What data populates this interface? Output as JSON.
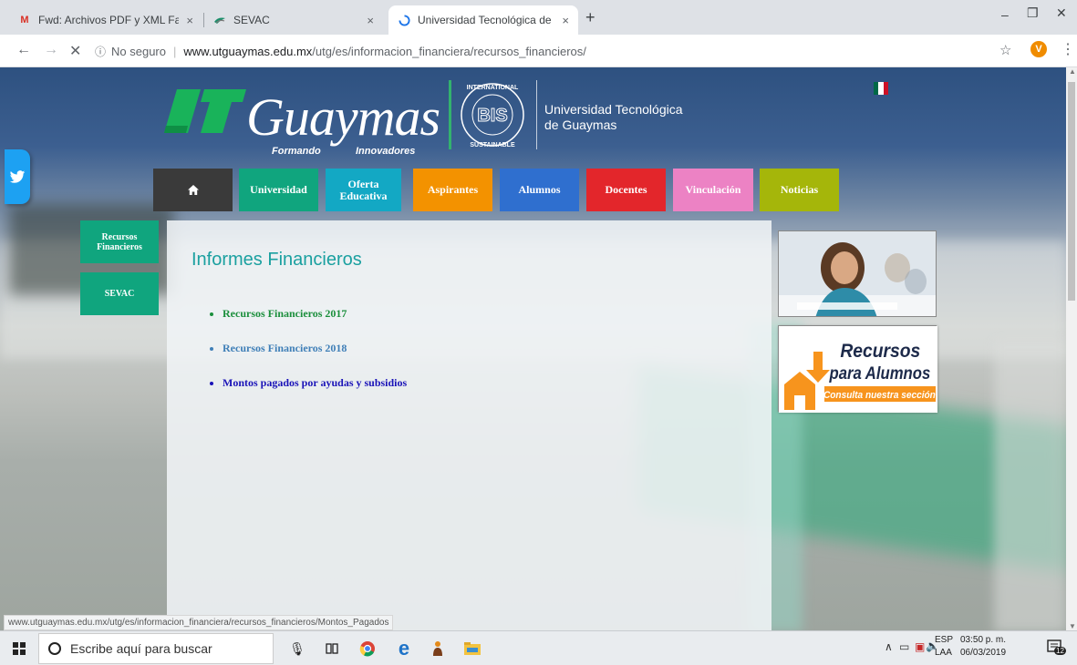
{
  "browser": {
    "tabs": [
      {
        "title": "Fwd: Archivos PDF y XML Factura",
        "icon": "gmail-icon"
      },
      {
        "title": "SEVAC",
        "icon": "sevac-favicon"
      },
      {
        "title": "Universidad Tecnológica de Guay",
        "icon": "loading-spinner-icon",
        "active": true
      }
    ],
    "close_glyph": "×",
    "new_tab_glyph": "+",
    "window_controls": {
      "minimize": "–",
      "restore": "❐",
      "close": "✕"
    },
    "nav": {
      "back": "←",
      "forward": "→",
      "stop": "✕"
    },
    "security_label": "No seguro",
    "url_host": "www.utguaymas.edu.mx",
    "url_path": "/utg/es/informacion_financiera/recursos_financieros/",
    "profile_initial": "V",
    "status_url": "www.utguaymas.edu.mx/utg/es/informacion_financiera/recursos_financieros/Montos_Pagados"
  },
  "header": {
    "logo_ut": "UT",
    "logo_word": "Guaymas",
    "logo_tag_left": "Formando",
    "logo_tag_right": "Innovadores",
    "seal_text": "BIS",
    "seal_ring_top": "BILINGUAL  INTERNATIONAL",
    "seal_ring_bottom": "SUSTAINABLE",
    "university_name_line1": "Universidad Tecnológica",
    "university_name_line2": "de Guaymas"
  },
  "nav": {
    "items": [
      {
        "label": "",
        "icon": "home-icon",
        "color": "#3a3a3a"
      },
      {
        "label": "Universidad",
        "color": "#10a57e"
      },
      {
        "label": "Oferta Educativa",
        "color": "#13a8c4"
      },
      {
        "label": "Aspirantes",
        "color": "#f39200"
      },
      {
        "label": "Alumnos",
        "color": "#2f6fcf"
      },
      {
        "label": "Docentes",
        "color": "#e3262b"
      },
      {
        "label": "Vinculación",
        "color": "#ec82c4"
      },
      {
        "label": "Noticias",
        "color": "#a5b60a"
      }
    ]
  },
  "sidebar": {
    "items": [
      {
        "label": "Recursos Financieros"
      },
      {
        "label": "SEVAC"
      }
    ]
  },
  "main": {
    "title": "Informes Financieros",
    "links": [
      {
        "label": "Recursos Financieros 2017",
        "color": "#1b8f3c"
      },
      {
        "label": "Recursos Financieros 2018",
        "color": "#3f7fb7"
      },
      {
        "label": "Montos pagados por ayudas y subsidios",
        "color": "#1a13b8"
      }
    ]
  },
  "banners": {
    "recursos_line1": "Recursos",
    "recursos_line2": "para Alumnos",
    "recursos_line3": "Consulta nuestra sección"
  },
  "taskbar": {
    "search_placeholder": "Escribe aquí para buscar",
    "lang_top": "ESP",
    "lang_bottom": "LAA",
    "time": "03:50 p. m.",
    "date": "06/03/2019",
    "notification_count": "12"
  },
  "colors": {
    "brand_green": "#10a57e",
    "title_teal": "#1aa0a0",
    "twitter_blue": "#1da1f2"
  }
}
